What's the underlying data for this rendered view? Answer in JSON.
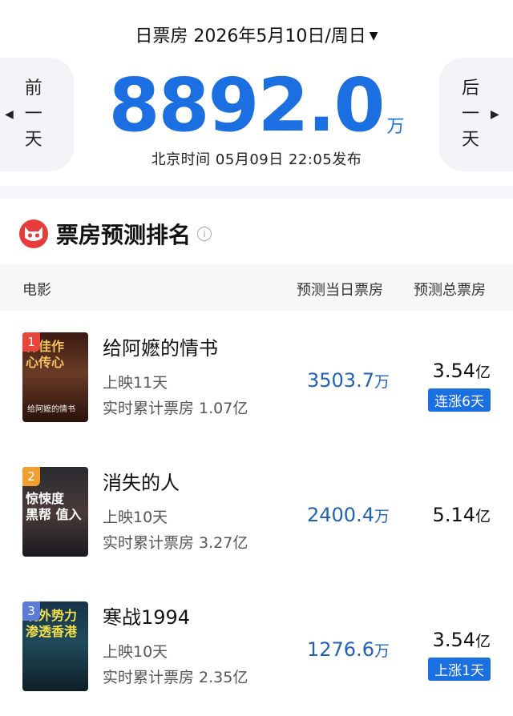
{
  "header": {
    "date_label": "日票房 2026年5月10日/周日",
    "caret": "▼",
    "prev_day": [
      "前",
      "一",
      "天"
    ],
    "next_day": [
      "后",
      "一",
      "天"
    ],
    "left_arrow": "◀",
    "right_arrow": "▶",
    "total_value": "8892.0",
    "total_unit": "万",
    "release_time": "北京时间 05月09日 22:05发布"
  },
  "section": {
    "title": "票房预测排名",
    "info_icon": "i"
  },
  "table": {
    "col_movie": "电影",
    "col_daily": "预测当日票房",
    "col_total": "预测总票房"
  },
  "movies": [
    {
      "rank": "1",
      "badge_color": "#e8453c",
      "poster_text": "禅佳作\n心传心",
      "poster_sub": "给阿嬷的情书",
      "title": "给阿嬷的情书",
      "days": "上映11天",
      "cumulative": "实时累计票房 1.07亿",
      "daily_num": "3503.7",
      "daily_unit": "万",
      "total_num": "3.54",
      "total_unit": "亿",
      "trend": "连涨6天"
    },
    {
      "rank": "2",
      "badge_color": "#f0a030",
      "poster_text": "惊悚度\n黑帮 值入",
      "poster_sub": "",
      "title": "消失的人",
      "days": "上映10天",
      "cumulative": "实时累计票房 3.27亿",
      "daily_num": "2400.4",
      "daily_unit": "万",
      "total_num": "5.14",
      "total_unit": "亿",
      "trend": ""
    },
    {
      "rank": "3",
      "badge_color": "#5b7bd6",
      "poster_text": "境外势力\n渗透香港",
      "poster_sub": "",
      "title": "寒战1994",
      "days": "上映10天",
      "cumulative": "实时累计票房 2.35亿",
      "daily_num": "1276.6",
      "daily_unit": "万",
      "total_num": "3.54",
      "total_unit": "亿",
      "trend": "上涨1天"
    }
  ],
  "colors": {
    "accent": "#1b6fe0",
    "daily_value": "#1f62b8",
    "logo_red": "#e83c3c"
  }
}
